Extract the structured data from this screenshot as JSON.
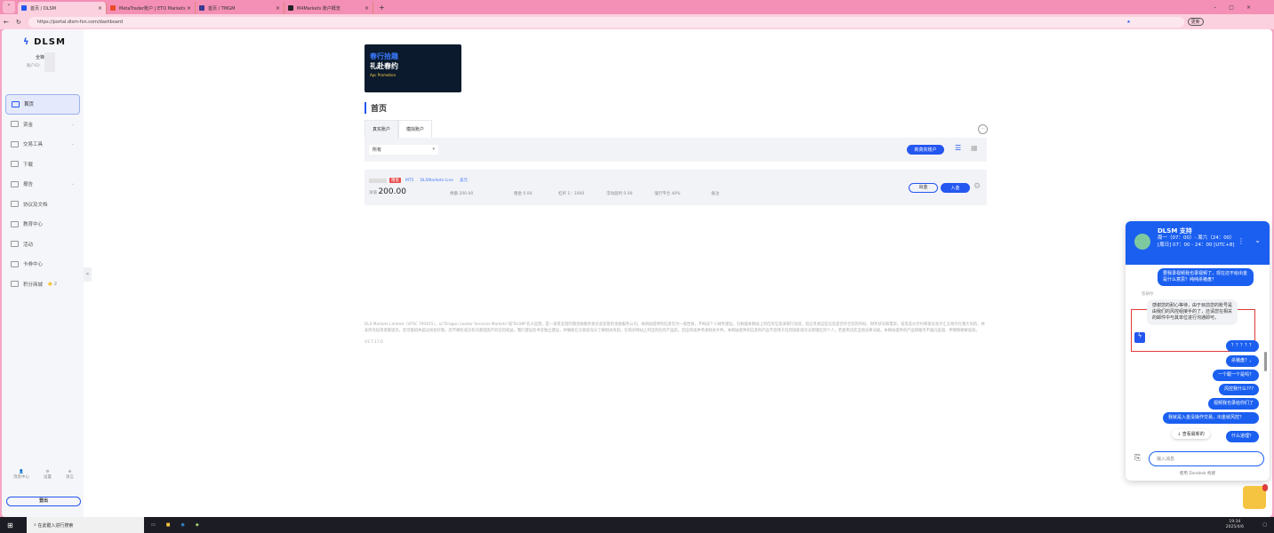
{
  "browser": {
    "tabs": [
      {
        "title": "首页 / DLSM",
        "color": "#2456f0"
      },
      {
        "title": "MetaTrader账户 | ETO Markets Li",
        "color": "#e84b2a"
      },
      {
        "title": "首页 / TMGM",
        "color": "#3b3b8f"
      },
      {
        "title": "M4Markets 账户概览",
        "color": "#222"
      }
    ],
    "url": "https://portal.dlsm-fxn.com/dashboard",
    "update_label": "更新"
  },
  "sidebar": {
    "brand": "DLSM",
    "user_name": "全锋",
    "account_id_label": "账户ID：",
    "items": [
      {
        "label": "首页",
        "active": true
      },
      {
        "label": "资金",
        "chevron": true
      },
      {
        "label": "交易工具",
        "chevron": true
      },
      {
        "label": "下载"
      },
      {
        "label": "报告",
        "chevron": true
      },
      {
        "label": "协议及文档"
      },
      {
        "label": "教育中心"
      },
      {
        "label": "活动"
      },
      {
        "label": "卡券中心"
      },
      {
        "label": "积分商城",
        "badge": "2"
      }
    ],
    "bottom": [
      "消息中心",
      "设置",
      "语言"
    ],
    "logout": "登出"
  },
  "banner": {
    "line1": "春行拾趣",
    "line2": "礼赴春约",
    "line3": "Apc Promotion"
  },
  "main": {
    "title": "首页",
    "tabs": [
      "真实账户",
      "模拟账户"
    ],
    "filter_value": "所有",
    "new_account": "新真实账户",
    "account": {
      "tags": [
        "赠金",
        "MT5",
        "DLSMarkets-Live",
        "美元"
      ],
      "net_label": "净值",
      "net_value": "200.00",
      "balance": "余额 200.00",
      "bonus": "赠金 0.00",
      "leverage": "杠杆 1：1000",
      "floating": "浮动盈利 0.00",
      "stopout": "强行平仓 40%",
      "note": "备注",
      "withdraw": "出金",
      "deposit": "入金"
    },
    "disclaimer": "DLS Markets Limited（VFSC 700455），以\"Dragon Leader Services Markets\"或\"DLSM\"名义运营，是一家受瓦努阿图金融服务委员会监管的金融服务公司。本网站提供的信息仅为一般性质，不构成个人财务建议。在根据本网站上的任何信息采取行动前，您应考虑这些信息是否符合您的目标、财务状况和需求。投资差价合约和保证金外汇交易存在重大风险，并非所有投资者都适合。您可能损失超过初始存款。您不拥有或没有对基础资产的任何权益。我们建议您寻求独立建议，并确保在交易前充分了解相关风险。在购买网站上列出的任何产品前，您应阅读并考虑相关文件。本网站提供的信息和产品不适用于任何国家或司法管辖区的个人，若使用违反当地法律法规。本网站提供的产品和服务不面向美国、伊朗和朝鲜居民。",
    "version": "V3.7.17.0"
  },
  "chat": {
    "title": "DLSM 支持",
    "hours": "周一（07：00）- 周六（24：00）[周日] 07：00 - 24：00 [UTC+8]",
    "agent_label": "答研尔",
    "messages": [
      {
        "from": "user",
        "text": "要我录视频我也录视频了，现在还不给出金是什么意思？纯纯杀猪盘？"
      },
      {
        "from": "agent",
        "text": "感谢您的耐心等待，由于目前您的账号是由我们的风控组接手的了，还请您在相关的邮件中与其单位进行沟通即可。"
      },
      {
        "from": "user",
        "text": "？？？？？"
      },
      {
        "from": "user",
        "text": "杀猪盘？，"
      },
      {
        "from": "user",
        "text": "一个跟一个是吗？"
      },
      {
        "from": "user",
        "text": "风控我什么???"
      },
      {
        "from": "user",
        "text": "视频我也录给你们了"
      },
      {
        "from": "user",
        "text": "我就是入金没操作交易，出金就风控？"
      },
      {
        "from": "user",
        "text": "什么道理？"
      }
    ],
    "see_latest": "查看最新的",
    "input_placeholder": "输入消息",
    "powered": "使用 Zendesk 构建"
  },
  "taskbar": {
    "search_placeholder": "在此键入进行搜索",
    "time": "19:34",
    "date": "2025/4/6"
  }
}
